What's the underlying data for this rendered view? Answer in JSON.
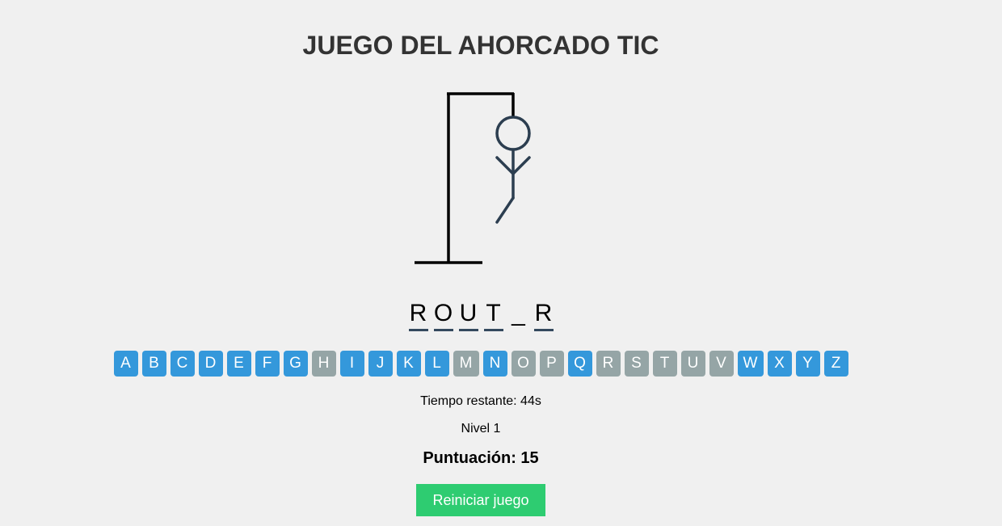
{
  "title": "JUEGO DEL AHORCADO TIC",
  "word": {
    "slots": [
      "R",
      "O",
      "U",
      "T",
      "_",
      "R"
    ],
    "underlined": [
      true,
      true,
      true,
      true,
      false,
      true
    ]
  },
  "keyboard": {
    "keys": [
      {
        "letter": "A",
        "used": false
      },
      {
        "letter": "B",
        "used": false
      },
      {
        "letter": "C",
        "used": false
      },
      {
        "letter": "D",
        "used": false
      },
      {
        "letter": "E",
        "used": false
      },
      {
        "letter": "F",
        "used": false
      },
      {
        "letter": "G",
        "used": false
      },
      {
        "letter": "H",
        "used": true
      },
      {
        "letter": "I",
        "used": false
      },
      {
        "letter": "J",
        "used": false
      },
      {
        "letter": "K",
        "used": false
      },
      {
        "letter": "L",
        "used": false
      },
      {
        "letter": "M",
        "used": true
      },
      {
        "letter": "N",
        "used": false
      },
      {
        "letter": "O",
        "used": true
      },
      {
        "letter": "P",
        "used": true
      },
      {
        "letter": "Q",
        "used": false
      },
      {
        "letter": "R",
        "used": true
      },
      {
        "letter": "S",
        "used": true
      },
      {
        "letter": "T",
        "used": true
      },
      {
        "letter": "U",
        "used": true
      },
      {
        "letter": "V",
        "used": true
      },
      {
        "letter": "W",
        "used": false
      },
      {
        "letter": "X",
        "used": false
      },
      {
        "letter": "Y",
        "used": false
      },
      {
        "letter": "Z",
        "used": false
      }
    ]
  },
  "status": {
    "timer": "Tiempo restante: 44s",
    "level": "Nivel 1",
    "score": "Puntuación: 15"
  },
  "restart_label": "Reiniciar juego",
  "colors": {
    "key_active": "#3498db",
    "key_used": "#95a5a6",
    "restart": "#2ecc71",
    "figure": "#2c3e50",
    "gallows": "#000000"
  }
}
